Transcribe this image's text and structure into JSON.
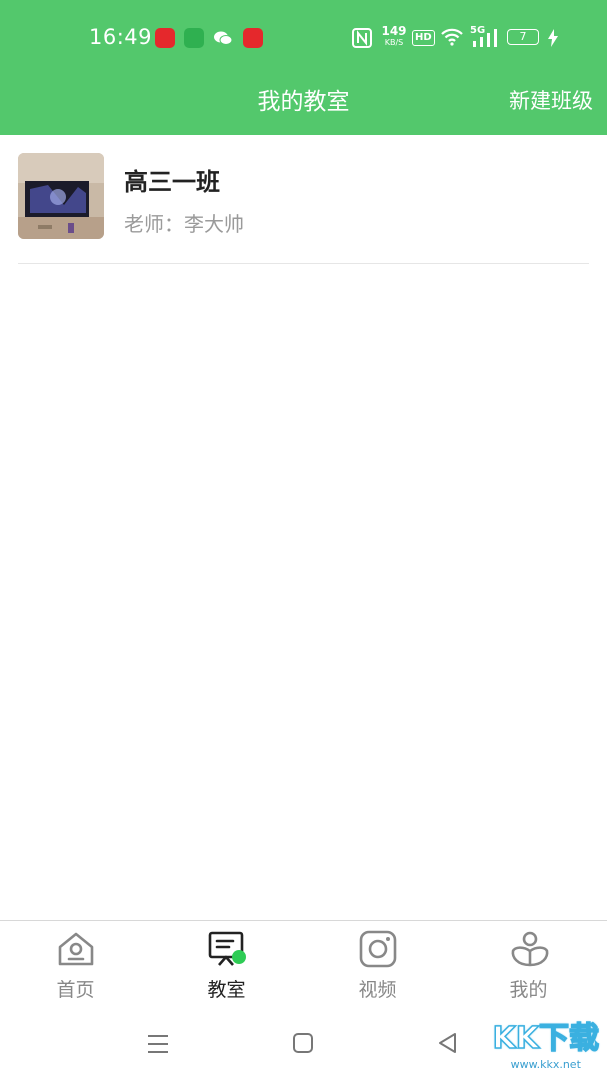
{
  "status_bar": {
    "time": "16:49",
    "network_speed_value": "149",
    "network_speed_unit": "KB/S",
    "hd": "HD",
    "signal": "5G",
    "battery": "7",
    "app_icons": [
      "video-app-icon",
      "message-icon",
      "wechat-icon",
      "toutiao-icon"
    ]
  },
  "header": {
    "title": "我的教室",
    "action": "新建班级"
  },
  "classes": [
    {
      "name": "高三一班",
      "teacher": "老师：李大帅"
    }
  ],
  "tabs": [
    {
      "label": "首页",
      "icon": "home-icon"
    },
    {
      "label": "教室",
      "icon": "classroom-icon",
      "active": true
    },
    {
      "label": "视频",
      "icon": "video-icon"
    },
    {
      "label": "我的",
      "icon": "profile-icon"
    }
  ],
  "watermark": {
    "text": "KK下载",
    "url": "www.kkx.net"
  },
  "colors": {
    "primary": "#53c86c",
    "accent_dot": "#2ecc55"
  }
}
